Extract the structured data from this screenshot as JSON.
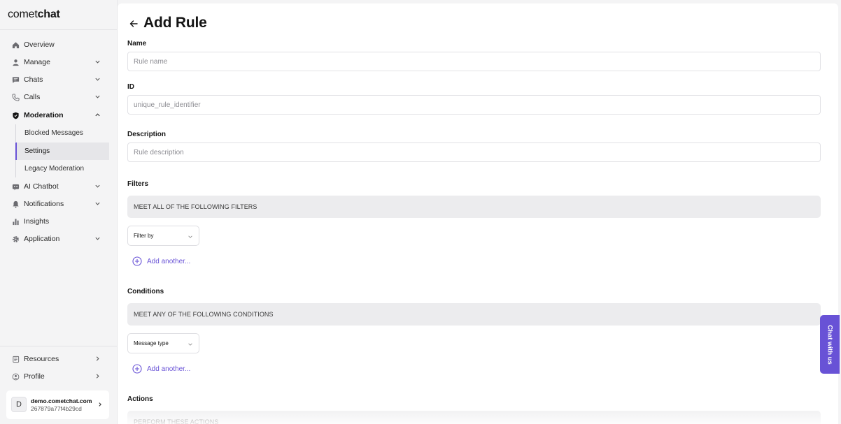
{
  "brand": {
    "prefix": "comet",
    "suffix": "chat"
  },
  "sidebar": {
    "items": [
      {
        "label": "Overview",
        "icon": "home-icon"
      },
      {
        "label": "Manage",
        "icon": "user-icon"
      },
      {
        "label": "Chats",
        "icon": "chat-bubble-icon"
      },
      {
        "label": "Calls",
        "icon": "phone-icon"
      },
      {
        "label": "Moderation",
        "icon": "shield-icon"
      },
      {
        "label": "AI Chatbot",
        "icon": "bot-icon"
      },
      {
        "label": "Notifications",
        "icon": "bell-icon"
      },
      {
        "label": "Insights",
        "icon": "bar-chart-icon"
      },
      {
        "label": "Application",
        "icon": "gear-icon"
      }
    ],
    "moderation_sub": [
      {
        "label": "Blocked Messages"
      },
      {
        "label": "Settings"
      },
      {
        "label": "Legacy Moderation"
      }
    ],
    "bottom": [
      {
        "label": "Resources",
        "icon": "book-icon"
      },
      {
        "label": "Profile",
        "icon": "profile-icon"
      }
    ],
    "account": {
      "initial": "D",
      "domain": "demo.cometchat.com",
      "id": "267879a77f4b29cd"
    }
  },
  "main": {
    "title": "Add Rule",
    "name_label": "Name",
    "name_placeholder": "Rule name",
    "id_label": "ID",
    "id_placeholder": "unique_rule_identifier",
    "description_label": "Description",
    "description_placeholder": "Rule description",
    "filters_label": "Filters",
    "filters_banner": "MEET ALL OF THE FOLLOWING FILTERS",
    "filter_select": "Filter by",
    "filters_add": "Add another...",
    "conditions_label": "Conditions",
    "conditions_banner": "MEET ANY OF THE FOLLOWING CONDITIONS",
    "condition_select": "Message type",
    "conditions_add": "Add another...",
    "actions_label": "Actions",
    "actions_banner": "PERFORM THESE ACTIONS"
  },
  "chat_widget": {
    "label": "Chat with us"
  },
  "colors": {
    "accent": "#6852d6",
    "sidebar_bg": "#f4f4f5",
    "banner_bg": "#ececee"
  }
}
